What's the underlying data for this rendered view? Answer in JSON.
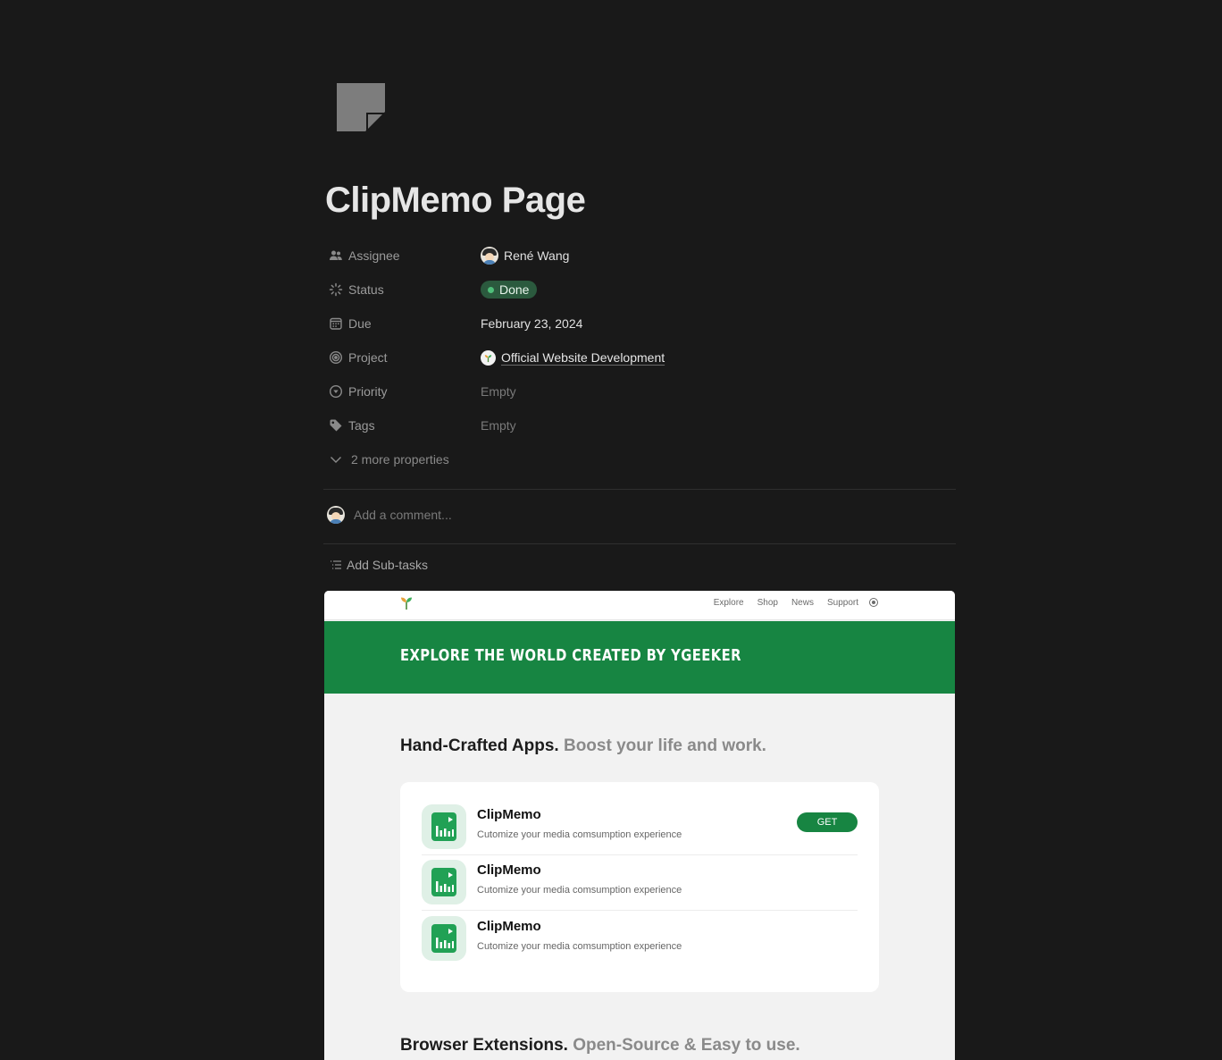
{
  "page": {
    "icon": "note-page-icon",
    "title": "ClipMemo Page"
  },
  "properties": [
    {
      "label": "Assignee",
      "icon": "people-icon",
      "value": "René Wang"
    },
    {
      "label": "Status",
      "icon": "status-icon",
      "value": "Done"
    },
    {
      "label": "Due",
      "icon": "calendar-icon",
      "value": "February 23, 2024"
    },
    {
      "label": "Project",
      "icon": "target-icon",
      "value": "Official Website Development"
    },
    {
      "label": "Priority",
      "icon": "priority-icon",
      "value": "Empty"
    },
    {
      "label": "Tags",
      "icon": "tag-icon",
      "value": "Empty"
    }
  ],
  "more_properties": "2 more properties",
  "comment": {
    "placeholder": "Add a comment..."
  },
  "subtasks": {
    "label": "Add Sub-tasks"
  },
  "colors": {
    "background": "#191919",
    "status_done": "#2b5a3e",
    "brand_green": "#178542"
  },
  "embed": {
    "nav": [
      "Explore",
      "Shop",
      "News",
      "Support"
    ],
    "hero_text": "EXPLORE THE WORLD CREATED BY YGEEKER",
    "apps_heading": "Hand-Crafted Apps.",
    "apps_subheading": "Boost your life and work.",
    "apps": [
      {
        "name": "ClipMemo",
        "desc": "Cutomize your media comsumption experience"
      },
      {
        "name": "ClipMemo",
        "desc": "Cutomize your media comsumption experience"
      },
      {
        "name": "ClipMemo",
        "desc": "Cutomize your media comsumption experience"
      }
    ],
    "get_label": "GET",
    "ext_heading": "Browser Extensions.",
    "ext_subheading": "Open-Source & Easy to use."
  }
}
